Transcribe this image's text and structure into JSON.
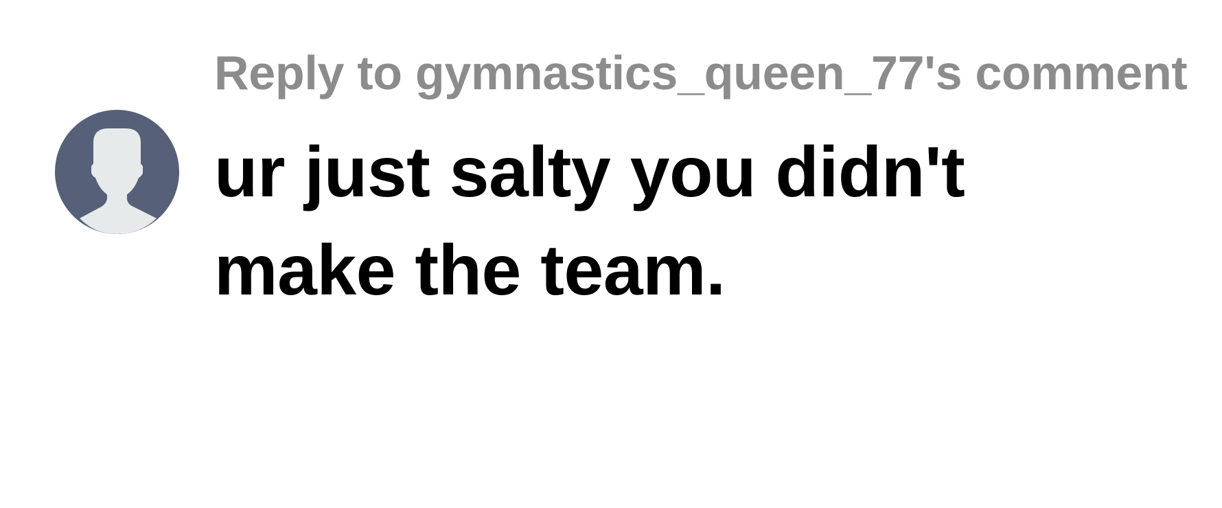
{
  "reply": {
    "header": "Reply to gymnastics_queen_77's comment",
    "comment_text": "ur just salty you didn't make the team.",
    "avatar_icon": "default-user-avatar-icon"
  },
  "colors": {
    "avatar_background": "#566079",
    "avatar_silhouette": "#e6eaeb",
    "header_text": "#8c8c8c",
    "comment_text": "#000000"
  }
}
